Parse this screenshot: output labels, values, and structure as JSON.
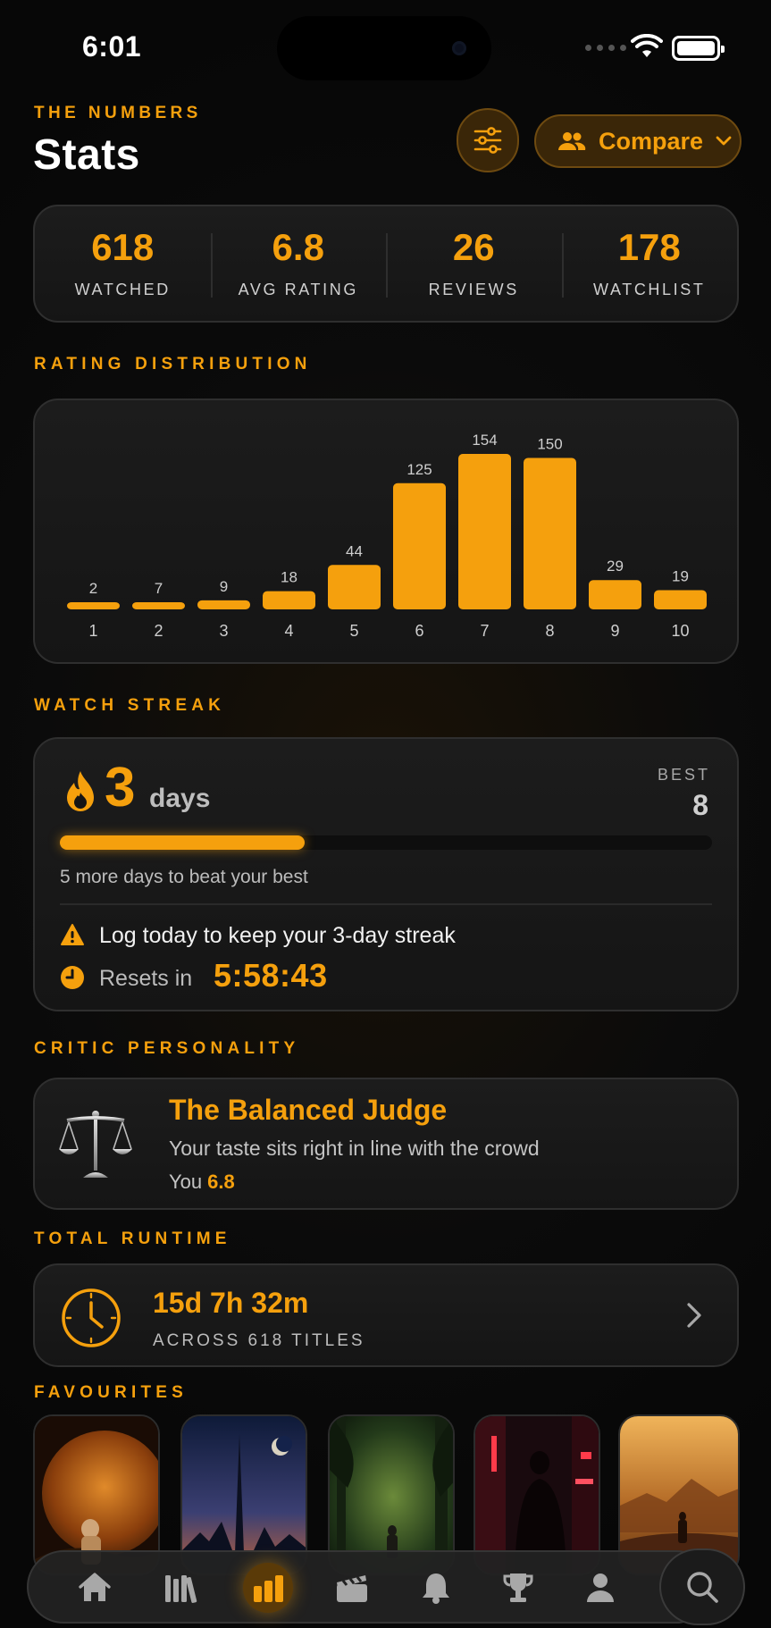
{
  "status_bar": {
    "time": "6:01"
  },
  "header": {
    "eyebrow": "THE NUMBERS",
    "title": "Stats",
    "compare_label": "Compare"
  },
  "summary": [
    {
      "value": "618",
      "label": "WATCHED"
    },
    {
      "value": "6.8",
      "label": "AVG RATING"
    },
    {
      "value": "26",
      "label": "REVIEWS"
    },
    {
      "value": "178",
      "label": "WATCHLIST"
    }
  ],
  "rating_distribution": {
    "title": "RATING DISTRIBUTION"
  },
  "chart_data": {
    "type": "bar",
    "categories": [
      "1",
      "2",
      "3",
      "4",
      "5",
      "6",
      "7",
      "8",
      "9",
      "10"
    ],
    "values": [
      2,
      7,
      9,
      18,
      44,
      125,
      154,
      150,
      29,
      19
    ],
    "title": "",
    "xlabel": "",
    "ylabel": "",
    "ylim": [
      0,
      154
    ],
    "grid": false,
    "data_labels": true,
    "color": "#f5a00d"
  },
  "streak": {
    "title": "WATCH STREAK",
    "current": "3",
    "unit": "days",
    "best_label": "BEST",
    "best_value": "8",
    "progress": 0.375,
    "beat_text": "5 more days to beat your best",
    "warning_text": "Log today to keep your 3-day streak",
    "resets_label": "Resets in",
    "resets_value": "5:58:43"
  },
  "personality": {
    "title": "CRITIC PERSONALITY",
    "name": "The Balanced Judge",
    "description": "Your taste sits right in line with the crowd",
    "you_label": "You",
    "you_value": "6.8"
  },
  "runtime": {
    "title": "TOTAL RUNTIME",
    "value": "15d 7h 32m",
    "subtitle": "ACROSS 618 TITLES"
  },
  "favourites": {
    "title": "FAVOURITES",
    "items": [
      "astronaut-moon-poster",
      "spire-city-poster",
      "forest-poster",
      "neon-city-poster",
      "desert-poster"
    ]
  },
  "tabbar": {
    "items": [
      "home-icon",
      "library-icon",
      "stats-icon",
      "clapperboard-icon",
      "bell-icon",
      "trophy-icon",
      "profile-icon"
    ],
    "active": "stats-icon"
  },
  "colors": {
    "accent": "#f5a00d",
    "background": "#0b0b0b",
    "card": "#181818"
  }
}
